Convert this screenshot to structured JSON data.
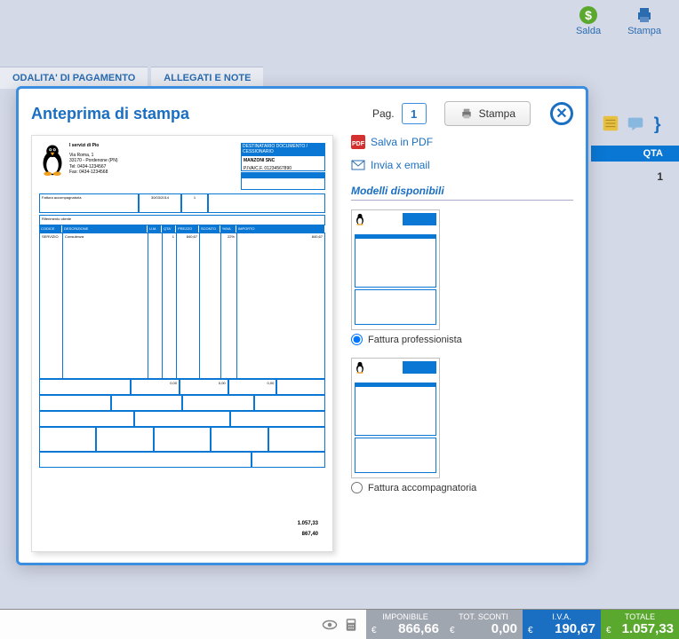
{
  "toolbar": {
    "salda": "Salda",
    "stampa": "Stampa"
  },
  "tabs": {
    "pagamento": "ODALITA' DI PAGAMENTO",
    "allegati": "ALLEGATI E NOTE"
  },
  "modal": {
    "title": "Anteprima di stampa",
    "pag_label": "Pag.",
    "page": "1",
    "stampa_btn": "Stampa",
    "side": {
      "salva_pdf": "Salva in PDF",
      "invia_email": "Invia x email",
      "models_title": "Modelli disponibili",
      "model1": "Fattura professionista",
      "model2": "Fattura accompagnatoria"
    },
    "doc": {
      "company_name": "I servizi di Pio",
      "addr1": "Via Roma, 1",
      "addr2": "33170 - Pordenone (PN)",
      "addr3": "Tel: 0434-1234567",
      "addr4": "Fax: 0434-1234568",
      "recipient_head": "DESTINATARIO DOCUMENTO / CESSIONARIO",
      "recipient_name": "MANZONI SNC",
      "recipient_piva": "P.IVA/C.F. 01234567890",
      "tipo_doc": "Fattura accompagnatoria",
      "data": "30/03/2014",
      "num": "1",
      "row2_label": "Riferimento cliente",
      "th_codice": "CODICE",
      "th_desc": "DESCRIZIONE",
      "th_um": "U.M.",
      "th_qta": "QTA'",
      "th_prezzo": "PREZZO",
      "th_sconto": "SCONTO",
      "th_iva": "%IVA",
      "th_importo": "IMPORTO",
      "item_code": "SERVIZIO",
      "item_desc": "Consulenza",
      "item_qta": "1",
      "item_prezzo": "840,67",
      "item_iva": "22%",
      "item_imp": "840,67",
      "footer_imp1": "0,00",
      "footer_imp2": "0,00",
      "footer_imp3": "0,00",
      "total1": "1.057,33",
      "total2": "867,40"
    }
  },
  "grid": {
    "header_qta": "QTA",
    "row_qta": "1"
  },
  "totals": {
    "currency": "€",
    "imponibile_label": "IMPONIBILE",
    "imponibile": "866,66",
    "sconti_label": "TOT. SCONTI",
    "sconti": "0,00",
    "iva_label": "I.V.A.",
    "iva": "190,67",
    "totale_label": "TOTALE",
    "totale": "1.057,33"
  }
}
